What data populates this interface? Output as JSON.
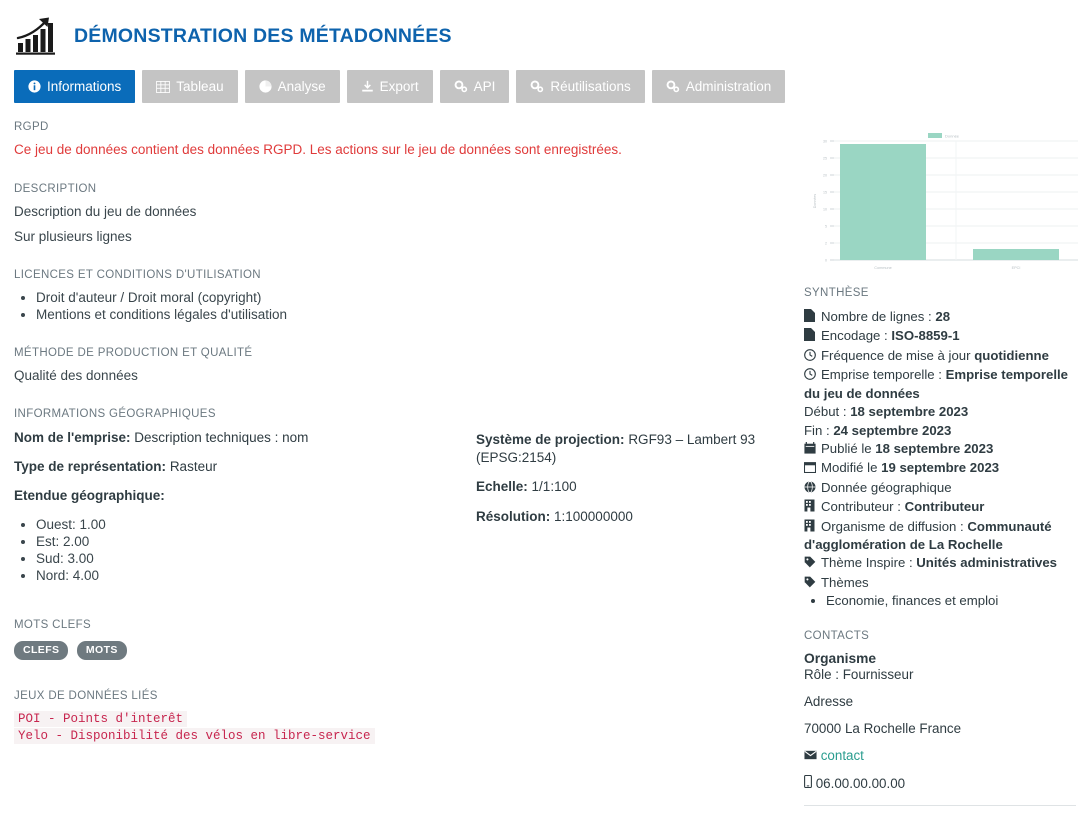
{
  "header": {
    "title": "DÉMONSTRATION DES MÉTADONNÉES",
    "logo_icon": "bar-chart-growth-icon",
    "accent_color": "#0e63ad"
  },
  "tabs": [
    {
      "label": "Informations",
      "icon": "info-circle-icon",
      "active": true
    },
    {
      "label": "Tableau",
      "icon": "table-icon",
      "active": false
    },
    {
      "label": "Analyse",
      "icon": "pie-chart-icon",
      "active": false
    },
    {
      "label": "Export",
      "icon": "download-icon",
      "active": false
    },
    {
      "label": "API",
      "icon": "gears-icon",
      "active": false
    },
    {
      "label": "Réutilisations",
      "icon": "gears-icon",
      "active": false
    },
    {
      "label": "Administration",
      "icon": "gears-icon",
      "active": false
    }
  ],
  "main": {
    "rgpd": {
      "title": "RGPD",
      "text": "Ce jeu de données contient des données RGPD. Les actions sur le jeu de données sont enregistrées.",
      "color": "#e03b3b"
    },
    "description": {
      "title": "DESCRIPTION",
      "lines": [
        "Description du jeu de données",
        "Sur plusieurs lignes"
      ]
    },
    "licences": {
      "title": "LICENCES ET CONDITIONS D'UTILISATION",
      "items": [
        "Droit d'auteur / Droit moral (copyright)",
        "Mentions et conditions légales d'utilisation"
      ]
    },
    "methode": {
      "title": "MÉTHODE DE PRODUCTION ET QUALITÉ",
      "text": "Qualité des données"
    },
    "geo": {
      "title": "INFORMATIONS GÉOGRAPHIQUES",
      "nom_emprise_label": "Nom de l'emprise:",
      "nom_emprise_value": "Description techniques : nom",
      "type_repr_label": "Type de représentation:",
      "type_repr_value": "Rasteur",
      "etendue_label": "Etendue géographique:",
      "etendue_items": [
        "Ouest: 1.00",
        "Est: 2.00",
        "Sud: 3.00",
        "Nord: 4.00"
      ],
      "projection_label": "Système de projection:",
      "projection_value": "RGF93 – Lambert 93 (EPSG:2154)",
      "echelle_label": "Echelle:",
      "echelle_value": "1/1:100",
      "resolution_label": "Résolution:",
      "resolution_value": "1:100000000"
    },
    "mots_clefs": {
      "title": "MOTS CLEFS",
      "tags": [
        "CLEFS",
        "MOTS"
      ]
    },
    "jeux_lies": {
      "title": "JEUX DE DONNÉES LIÉS",
      "items": [
        "POI - Points d'interêt",
        "Yelo - Disponibilité des vélos en libre-service"
      ]
    }
  },
  "chart_data": {
    "type": "bar",
    "categories": [
      "Commune",
      "EPCI"
    ],
    "values": [
      28,
      2
    ],
    "series": [
      {
        "name": "Donnée",
        "values": [
          28,
          2
        ]
      }
    ],
    "title": "",
    "xlabel": "",
    "ylabel": "Données",
    "ylim": [
      0,
      30
    ],
    "yticks": [
      0,
      5,
      10,
      15,
      20,
      25,
      30
    ],
    "grid": true,
    "legend": "top-center",
    "legend_entries": [
      "Donnée"
    ],
    "bar_color": "#9ad6c3"
  },
  "synthese": {
    "title": "SYNTHÈSE",
    "rows": [
      {
        "icon": "file-icon",
        "label": "Nombre de lignes : ",
        "value": "28"
      },
      {
        "icon": "file-icon",
        "label": "Encodage : ",
        "value": "ISO-8859-1"
      },
      {
        "icon": "clock-icon",
        "label": "Fréquence de mise à jour ",
        "value": "quotidienne"
      },
      {
        "icon": "clock-icon",
        "label": "Emprise temporelle : ",
        "value": "Emprise temporelle du jeu de données"
      },
      {
        "icon": "none",
        "label": "Début : ",
        "value": "18 septembre 2023"
      },
      {
        "icon": "none",
        "label": "Fin : ",
        "value": "24 septembre 2023"
      },
      {
        "icon": "calendar-icon",
        "label": "Publié le ",
        "value": "18 septembre 2023"
      },
      {
        "icon": "calendar-alt-icon",
        "label": "Modifié le ",
        "value": "19 septembre 2023"
      },
      {
        "icon": "globe-icon",
        "label": "Donnée géographique",
        "value": ""
      },
      {
        "icon": "building-icon",
        "label": "Contributeur : ",
        "value": "Contributeur"
      },
      {
        "icon": "building-icon",
        "label": "Organisme de diffusion : ",
        "value": "Communauté d'agglomération de La Rochelle"
      },
      {
        "icon": "tag-icon",
        "label": "Thème Inspire : ",
        "value": "Unités administratives"
      },
      {
        "icon": "tag-icon",
        "label": "Thèmes",
        "value": ""
      }
    ],
    "themes": [
      "Economie, finances et emploi"
    ]
  },
  "contacts": {
    "title": "CONTACTS",
    "organisme": "Organisme",
    "role": "Rôle : Fournisseur",
    "adresse_label": "Adresse",
    "adresse_value": "70000 La Rochelle France",
    "email_label": "contact",
    "email_icon": "envelope-icon",
    "phone": "06.00.00.00.00",
    "phone_icon": "mobile-icon",
    "link_color": "#2a9d8f"
  }
}
